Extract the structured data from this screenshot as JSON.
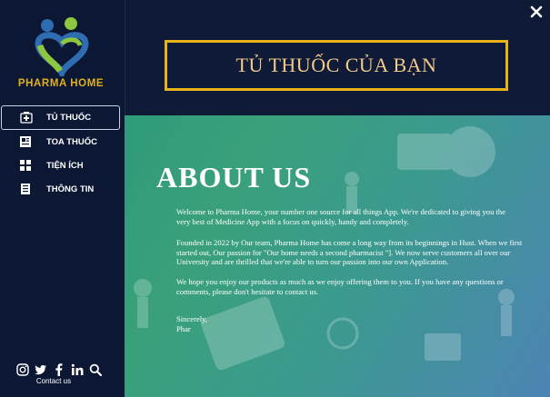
{
  "brand": {
    "name": "PHARMA HOME",
    "colors": {
      "blue": "#2f6db3",
      "green": "#8dc63f",
      "gold": "#e0b021"
    }
  },
  "nav": {
    "items": [
      {
        "label": "TỦ THUỐC",
        "icon": "medicine-box-icon",
        "active": true
      },
      {
        "label": "TOA THUỐC",
        "icon": "prescription-icon",
        "active": false
      },
      {
        "label": "TIỆN ÍCH",
        "icon": "grid-icon",
        "active": false
      },
      {
        "label": "THÔNG TIN",
        "icon": "document-icon",
        "active": false
      }
    ]
  },
  "social": {
    "icons": [
      "instagram-icon",
      "twitter-icon",
      "facebook-icon",
      "linkedin-icon",
      "search-icon"
    ],
    "contact_label": "Contact us"
  },
  "header": {
    "title": "TỦ THUỐC CỦA BẠN",
    "border_color": "#e6b417"
  },
  "about": {
    "heading": "ABOUT US",
    "p1": "Welcome to Pharma Home, your number one source for all things App. We're dedicated to giving you the\nvery best of  Medicine App with a focus on quickly, handy and completely.",
    "p2": "Founded in 2022 by Our team, Pharma Home has come a long way from its beginnings in Hust. When we first\nstarted out, Our passion for \"Our home needs a second pharmacist \"]. We now serve customers all over our\nUniversity and are thrilled that we're able to turn our passion into our own Application.",
    "p3": "We hope you enjoy our products as much as we enjoy offering them to you. If you have any questions or\ncomments, please don't hesitate to contact us.",
    "sign": "Sincerely,\n     Phar"
  }
}
